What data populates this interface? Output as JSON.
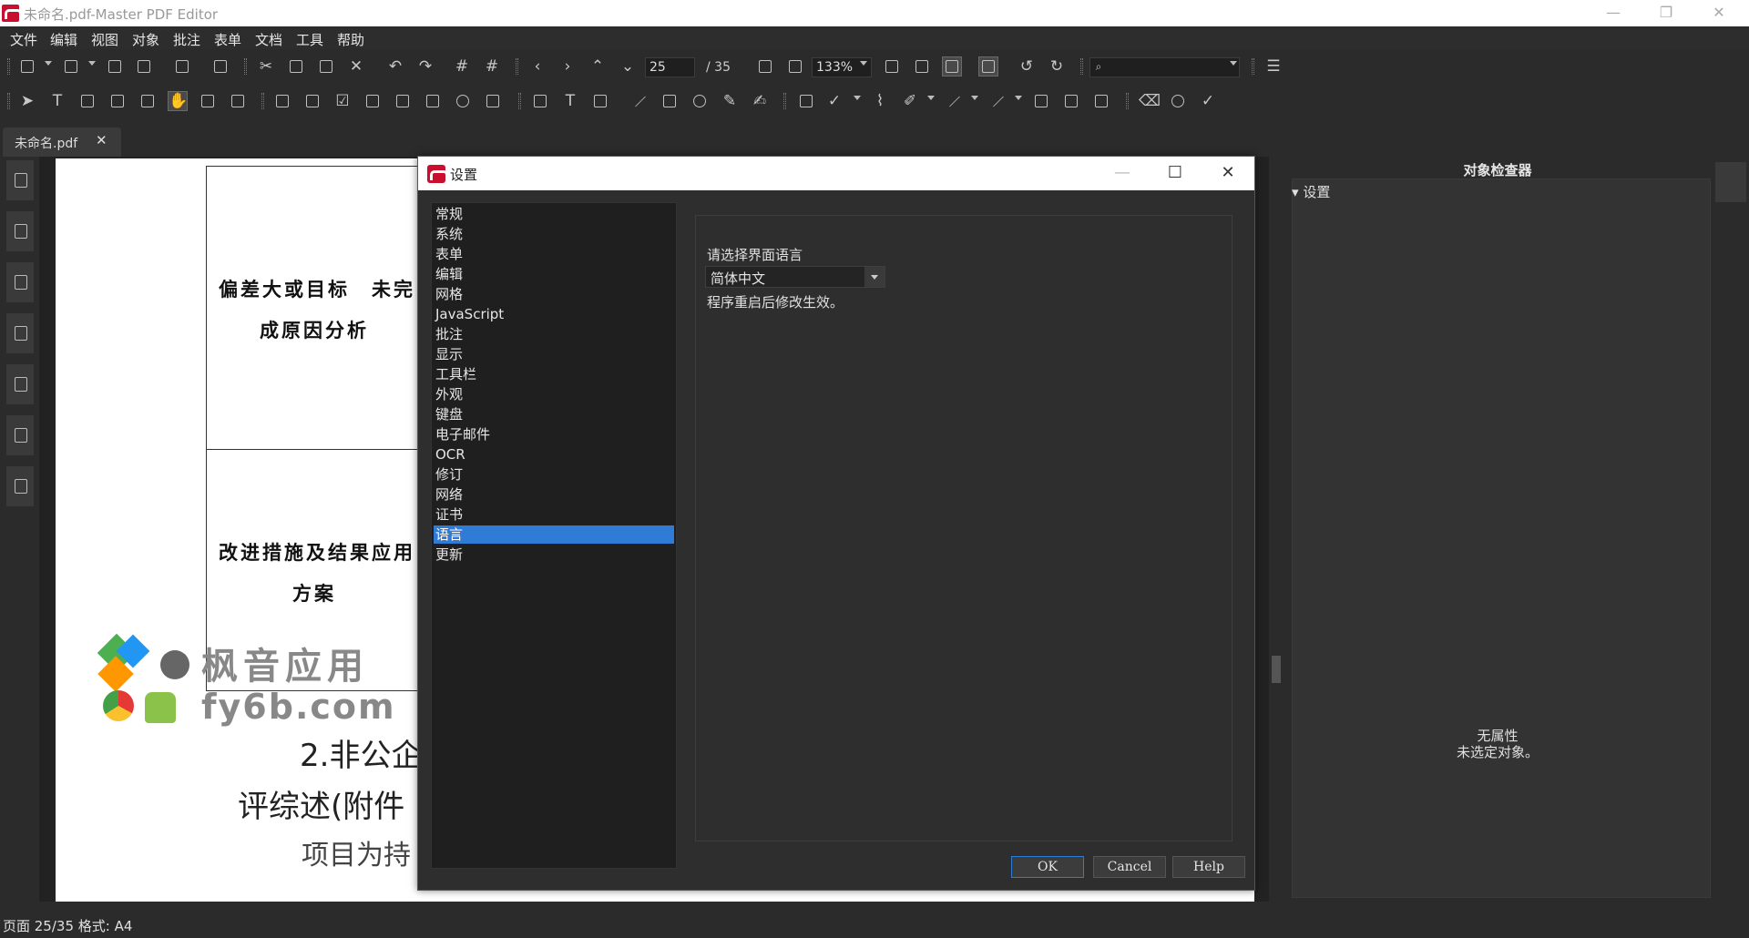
{
  "window": {
    "title": "未命名.pdf-Master PDF Editor",
    "minimize": "—",
    "restore": "❐",
    "close": "✕"
  },
  "menu": [
    "文件",
    "编辑",
    "视图",
    "对象",
    "批注",
    "表单",
    "文档",
    "工具",
    "帮助"
  ],
  "toolbar": {
    "page_current": "25",
    "page_total": "/ 35",
    "zoom": "133%",
    "search_placeholder": ""
  },
  "tab": {
    "label": "未命名.pdf",
    "close": "✕"
  },
  "document": {
    "cell1_line1": "偏差大或目标　未完",
    "cell1_line2": "成原因分析",
    "cell2_line1": "改进措施及结果应用",
    "cell2_line2": "方案",
    "heading1": "2.非公企",
    "heading2": "评综述(附件",
    "heading3": "项目为持",
    "watermark1": "枫音应用",
    "watermark2": "fy6b.com"
  },
  "dialog": {
    "title": "设置",
    "categories": [
      "常规",
      "系统",
      "表单",
      "编辑",
      "网格",
      "JavaScript",
      "批注",
      "显示",
      "工具栏",
      "外观",
      "键盘",
      "电子邮件",
      "OCR",
      "修订",
      "网络",
      "证书",
      "语言",
      "更新"
    ],
    "selected_index": 16,
    "language_label": "请选择界面语言",
    "language_value": "简体中文",
    "restart_note": "程序重启后修改生效。",
    "ok": "OK",
    "cancel": "Cancel",
    "help": "Help"
  },
  "inspector": {
    "title": "对象检查器",
    "section": "设置",
    "empty_line1": "无属性",
    "empty_line2": "未选定对象。"
  },
  "status": {
    "text": "页面 25/35 格式: A4"
  },
  "colors": {
    "accent": "#2f7bd6",
    "brand": "#c8102e"
  }
}
